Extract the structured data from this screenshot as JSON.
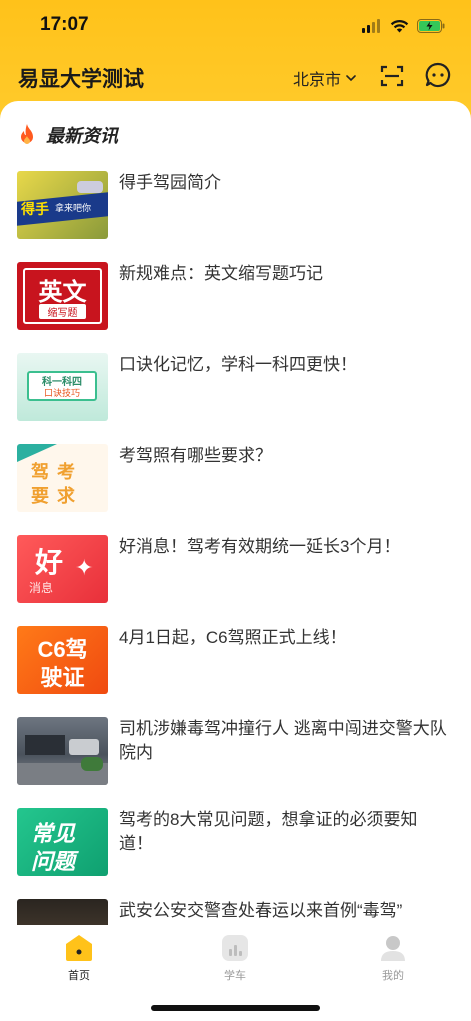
{
  "status_bar": {
    "time": "17:07"
  },
  "header": {
    "app_title": "易显大学测试",
    "city": "北京市"
  },
  "section": {
    "title": "最新资讯"
  },
  "news": [
    {
      "title": "得手驾园简介",
      "thumb_text": "得手",
      "thumb_sub": "拿来吧你"
    },
    {
      "title": "新规难点：英文缩写题巧记",
      "thumb_text": "英文",
      "thumb_sub": "缩写题"
    },
    {
      "title": "口诀化记忆，学科一科四更快！",
      "thumb_text": "科一科四",
      "thumb_sub": "口诀技巧"
    },
    {
      "title": "考驾照有哪些要求？",
      "thumb_text": "驾考",
      "thumb_sub": "要求"
    },
    {
      "title": "好消息！驾考有效期统一延长3个月！",
      "thumb_text": "好",
      "thumb_sub": "消息"
    },
    {
      "title": "4月1日起，C6驾照正式上线！",
      "thumb_text": "C6驾",
      "thumb_sub": "驶证"
    },
    {
      "title": "司机涉嫌毒驾冲撞行人 逃离中闯进交警大队院内",
      "thumb_text": "",
      "thumb_sub": ""
    },
    {
      "title": "驾考的8大常见问题，想拿证的必须要知道！",
      "thumb_text": "常见",
      "thumb_sub": "问题"
    },
    {
      "title": "武安公安交警查处春运以来首例“毒驾”",
      "thumb_text": "",
      "thumb_sub": ""
    }
  ],
  "tabbar": {
    "items": [
      {
        "label": "首页",
        "icon": "home-icon",
        "active": true
      },
      {
        "label": "学车",
        "icon": "chart-icon",
        "active": false
      },
      {
        "label": "我的",
        "icon": "user-icon",
        "active": false
      }
    ]
  },
  "colors": {
    "brand": "#ffc21a",
    "text": "#333333",
    "muted": "#999999"
  }
}
